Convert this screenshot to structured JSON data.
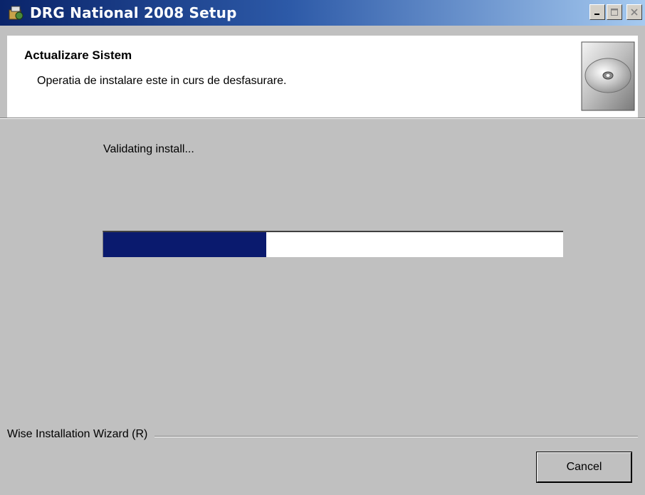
{
  "window": {
    "title": "DRG National 2008 Setup",
    "title_bar_color": "#0a246a"
  },
  "header": {
    "title": "Actualizare Sistem",
    "subtitle": "Operatia de instalare este in curs de desfasurare."
  },
  "status": {
    "text": "Validating install..."
  },
  "progress": {
    "fraction": 0.355,
    "fill_color": "#0a1a6e"
  },
  "footer": {
    "label": "Wise Installation Wizard (R)",
    "cancel_label": "Cancel"
  },
  "icons": [
    "setup-app-icon",
    "minimize-icon",
    "maximize-icon",
    "close-icon",
    "cd-disc-icon"
  ]
}
